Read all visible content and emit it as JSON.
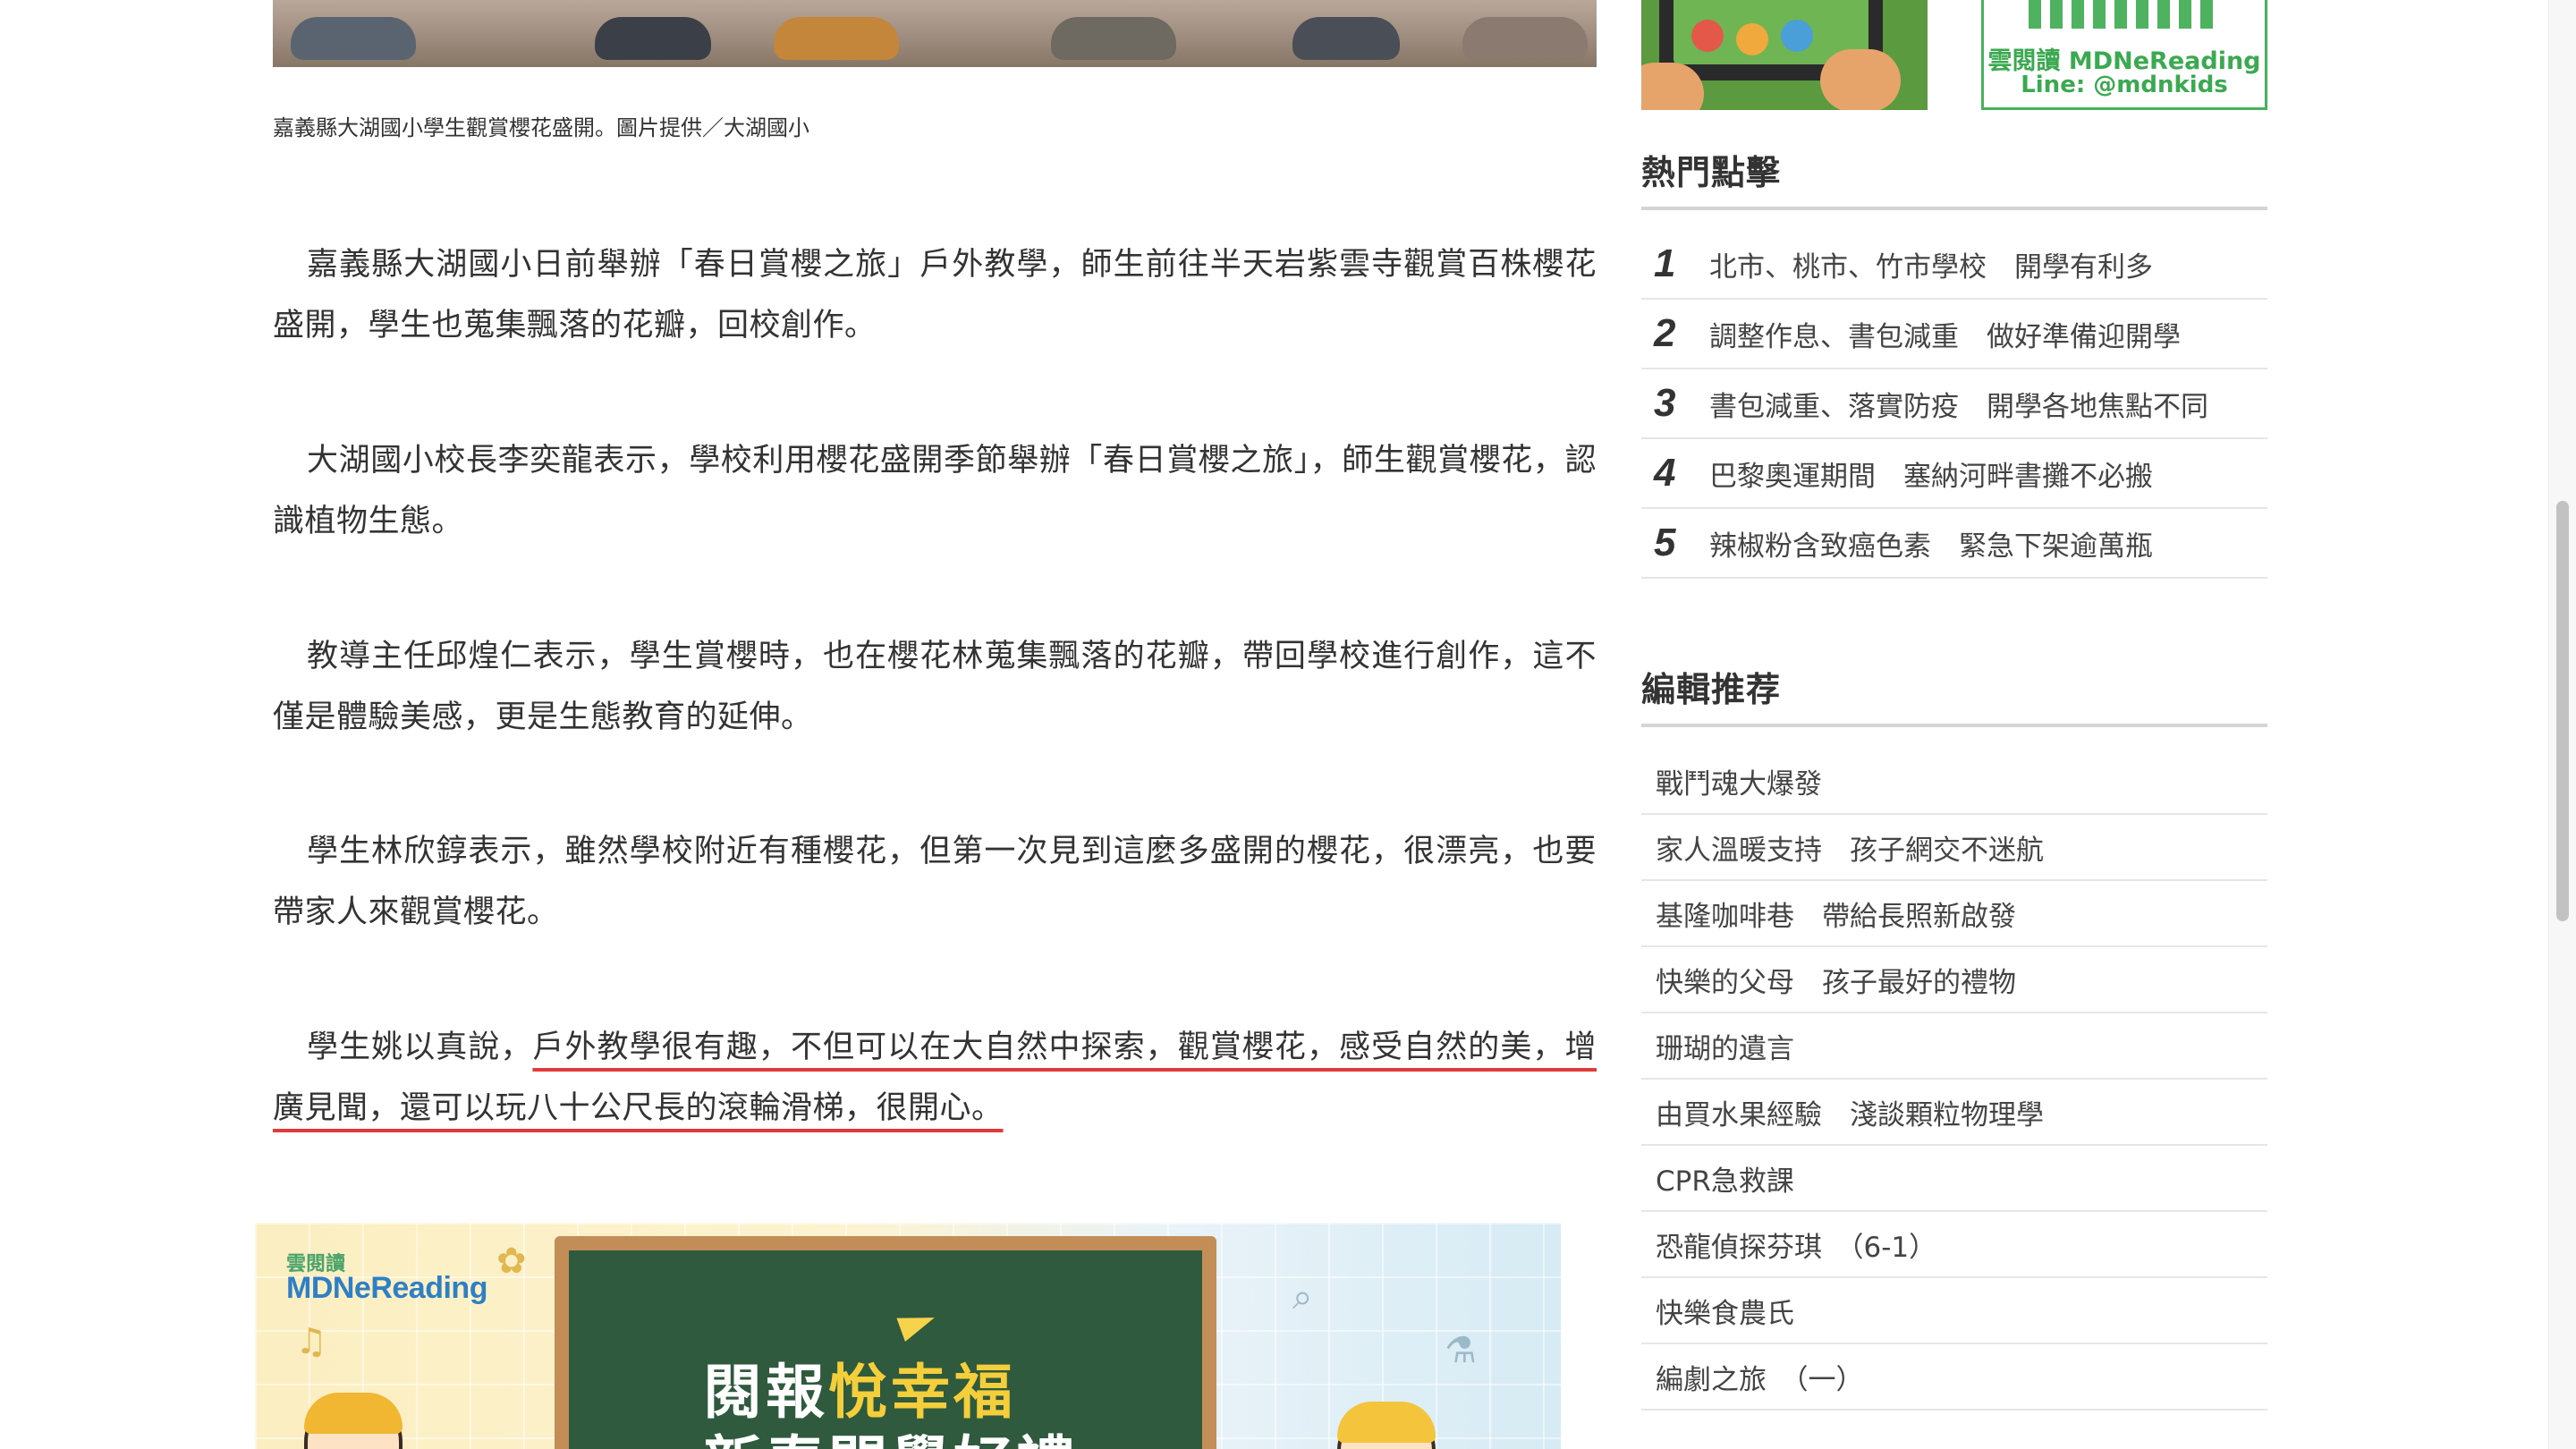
{
  "article": {
    "photo_caption": "嘉義縣大湖國小學生觀賞櫻花盛開。圖片提供／大湖國小",
    "paragraphs": [
      "嘉義縣大湖國小日前舉辦「春日賞櫻之旅」戶外教學，師生前往半天岩紫雲寺觀賞百株櫻花盛開，學生也蒐集飄落的花瓣，回校創作。",
      "大湖國小校長李奕龍表示，學校利用櫻花盛開季節舉辦「春日賞櫻之旅」，師生觀賞櫻花，認識植物生態。",
      "教導主任邱煌仁表示，學生賞櫻時，也在櫻花林蒐集飄落的花瓣，帶回學校進行創作，這不僅是體驗美感，更是生態教育的延伸。",
      "學生林欣錞表示，雖然學校附近有種櫻花，但第一次見到這麼多盛開的櫻花，很漂亮，也要帶家人來觀賞櫻花。"
    ],
    "last_paragraph": {
      "prefix": "學生姚以真說，",
      "highlighted": "戶外教學很有趣，不但可以在大自然中探索，觀賞櫻花，感受自然的美，增廣見聞，還可以玩八十公尺長的滾輪滑梯，很開心。"
    }
  },
  "promo_banner": {
    "logo_small": "雲閱讀",
    "logo": "MDNeReading",
    "title_accent": "悅幸福",
    "title_prefix": "閱報",
    "title_line2": "新春開學好禮"
  },
  "sidebar": {
    "ad_line": {
      "line1": "雲閱讀 MDNeReading",
      "line2": "Line: @mdnkids"
    },
    "hot_heading": "熱門點擊",
    "hot_items": [
      {
        "rank": "1",
        "title": "北市、桃市、竹市學校　開學有利多"
      },
      {
        "rank": "2",
        "title": "調整作息、書包減重　做好準備迎開學"
      },
      {
        "rank": "3",
        "title": "書包減重、落實防疫　開學各地焦點不同"
      },
      {
        "rank": "4",
        "title": "巴黎奧運期間　塞納河畔書攤不必搬"
      },
      {
        "rank": "5",
        "title": "辣椒粉含致癌色素　緊急下架逾萬瓶"
      }
    ],
    "editor_heading": "編輯推荐",
    "editor_items": [
      "戰鬥魂大爆發",
      "家人溫暖支持　孩子網交不迷航",
      "基隆咖啡巷　帶給長照新啟發",
      "快樂的父母　孩子最好的禮物",
      "珊瑚的遺言",
      "由買水果經驗　淺談顆粒物理學",
      "CPR急救課",
      "恐龍偵探芬琪　（6-1）",
      "快樂食農氏",
      "編劇之旅　（一）"
    ]
  },
  "colors": {
    "underline": "#e03a3a",
    "brand_green": "#3aa94f",
    "chalkboard": "#2f5a3e",
    "accent_yellow": "#f4cf3b"
  },
  "icons": [
    "tablet-ad-icon",
    "qr-code-icon",
    "paper-plane-icon"
  ]
}
